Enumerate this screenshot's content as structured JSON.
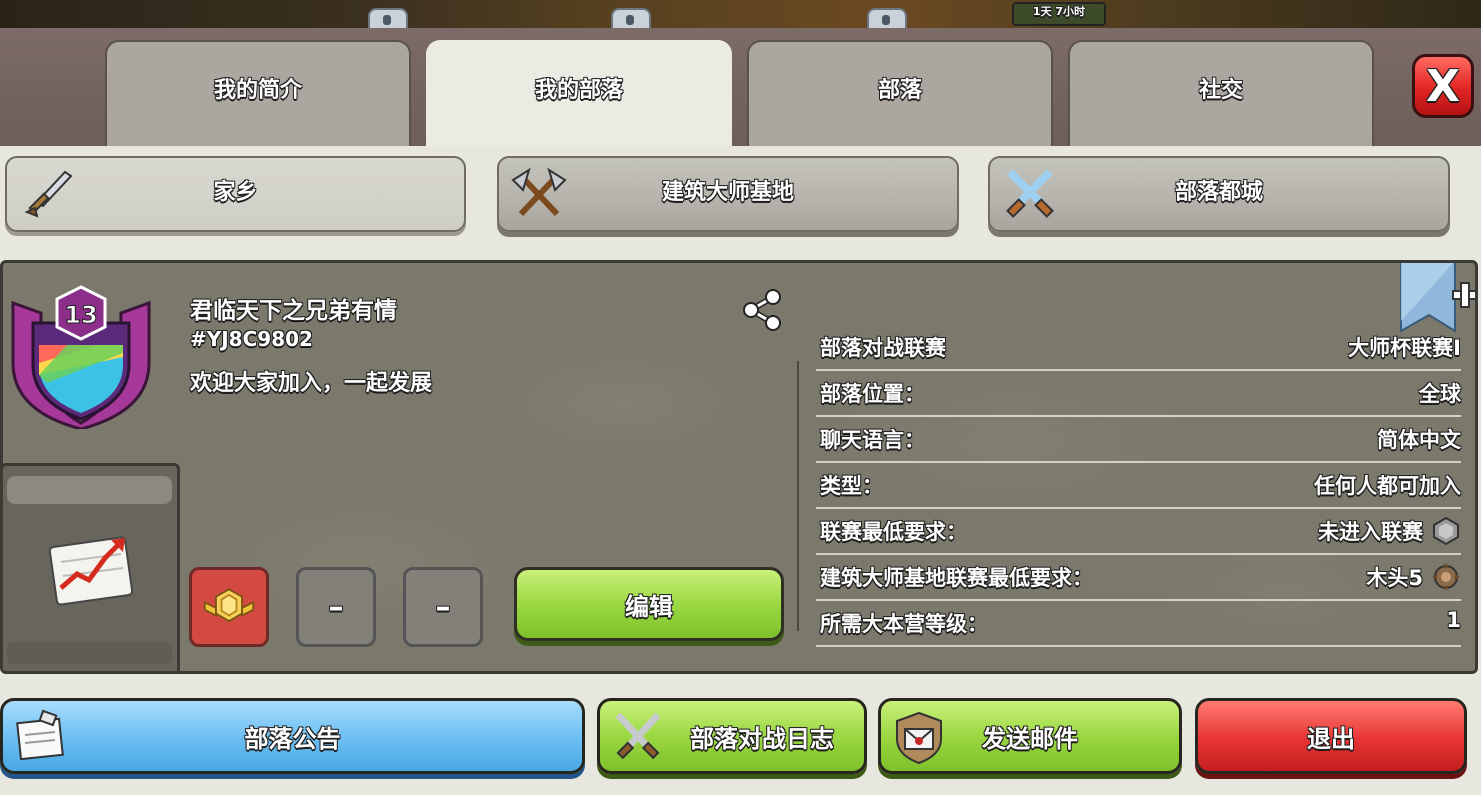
{
  "game_strip": {
    "timer": "1天 7小时"
  },
  "tabs": [
    {
      "label": "我的简介"
    },
    {
      "label": "我的部落"
    },
    {
      "label": "部落"
    },
    {
      "label": "社交"
    }
  ],
  "close": {
    "label": "X"
  },
  "subtabs": [
    {
      "label": "家乡",
      "icon": "sword-icon"
    },
    {
      "label": "建筑大师基地",
      "icon": "crossed-axes-icon"
    },
    {
      "label": "部落都城",
      "icon": "crossed-swords-icon"
    }
  ],
  "clan": {
    "level": "13",
    "name": "君临天下之兄弟有情",
    "tag": "#YJ8C9802",
    "description": "欢迎大家加入，一起发展"
  },
  "rank_slots": [
    {
      "type": "trophy",
      "icon": "gold-league-badge-icon"
    },
    {
      "type": "empty",
      "label": "–"
    },
    {
      "type": "empty",
      "label": "–"
    }
  ],
  "edit_button": {
    "label": "编辑"
  },
  "info": [
    {
      "label": "部落对战联赛",
      "value": "大师杯联赛Ⅰ"
    },
    {
      "label": "部落位置：",
      "value": "全球"
    },
    {
      "label": "聊天语言：",
      "value": "简体中文"
    },
    {
      "label": "类型：",
      "value": "任何人都可加入"
    },
    {
      "label": "联赛最低要求：",
      "value": "未进入联赛",
      "icon": "unranked-league-icon"
    },
    {
      "label": "建筑大师基地联赛最低要求：",
      "value": "木头5",
      "icon": "wood-league-icon"
    },
    {
      "label": "所需大本营等级：",
      "value": "1"
    }
  ],
  "bottom_buttons": [
    {
      "label": "部落公告",
      "icon": "notice-paper-icon",
      "color": "#6fc0f3"
    },
    {
      "label": "部落对战日志",
      "icon": "crossed-swords-icon",
      "color": "#9bd843"
    },
    {
      "label": "发送邮件",
      "icon": "mail-shield-icon",
      "color": "#9bd843"
    },
    {
      "label": "退出",
      "color": "#e83434"
    }
  ],
  "colors": {
    "panel_bg": "#7b786c",
    "tab_active": "#ebeae3",
    "tab_inactive": "#aba7a0",
    "close_red": "#e12424"
  }
}
